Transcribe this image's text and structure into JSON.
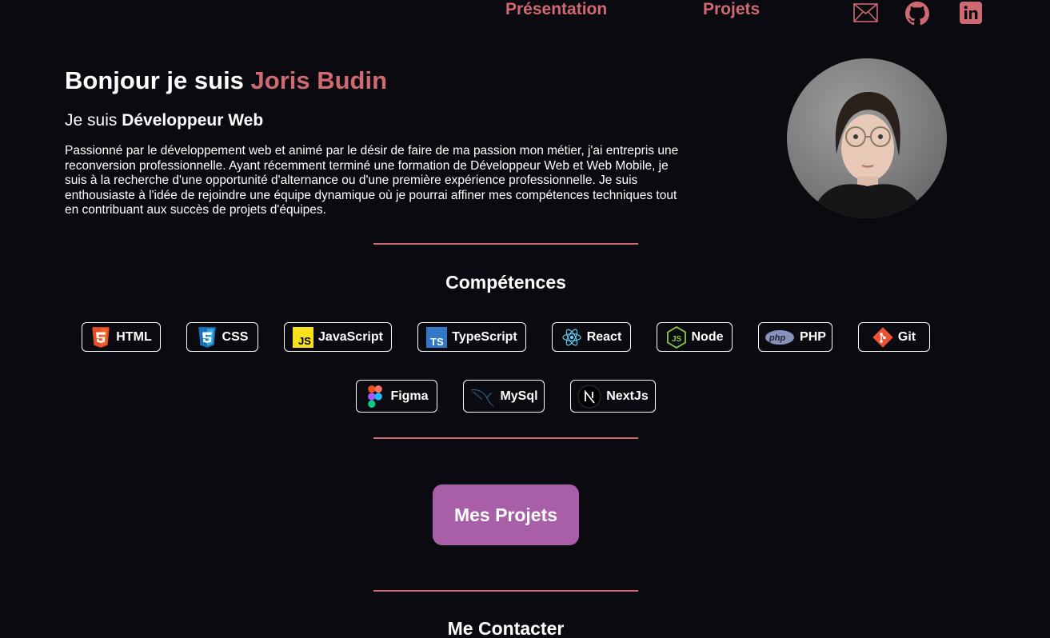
{
  "nav": {
    "presentation": "Présentation",
    "projects": "Projets",
    "socials": [
      {
        "icon": "mail-icon"
      },
      {
        "icon": "github-icon"
      },
      {
        "icon": "linkedin-icon"
      }
    ]
  },
  "hero": {
    "greeting": "Bonjour je suis ",
    "name": "Joris Budin",
    "sub_prefix": "Je suis ",
    "role": "Développeur Web",
    "description": "Passionné par le développement web et animé par le désir de faire de ma passion mon métier, j'ai entrepris une reconversion professionnelle. Ayant récemment terminé une formation de Développeur Web et Web Mobile, je suis à la recherche d'une opportunité d'alternance ou d'une première expérience professionnelle. Je suis enthousiaste à l'idée de rejoindre une équipe dynamique où je pourrai affiner mes compétences techniques tout en contribuant aux succès de projets d'équipes."
  },
  "skills": {
    "title": "Compétences",
    "items": [
      {
        "label": "HTML",
        "icon": "html5-icon"
      },
      {
        "label": "CSS",
        "icon": "css3-icon"
      },
      {
        "label": "JavaScript",
        "icon": "javascript-icon"
      },
      {
        "label": "TypeScript",
        "icon": "typescript-icon"
      },
      {
        "label": "React",
        "icon": "react-icon"
      },
      {
        "label": "Node",
        "icon": "nodejs-icon"
      },
      {
        "label": "PHP",
        "icon": "php-icon"
      },
      {
        "label": "Git",
        "icon": "git-icon"
      },
      {
        "label": "Figma",
        "icon": "figma-icon"
      },
      {
        "label": "MySql",
        "icon": "mysql-icon"
      },
      {
        "label": "NextJs",
        "icon": "nextjs-icon"
      }
    ]
  },
  "cta": {
    "label": "Mes Projets"
  },
  "contact": {
    "title": "Me Contacter"
  },
  "colors": {
    "background": "#0a0a10",
    "accent": "#d06a72",
    "button": "#a85fa8"
  }
}
